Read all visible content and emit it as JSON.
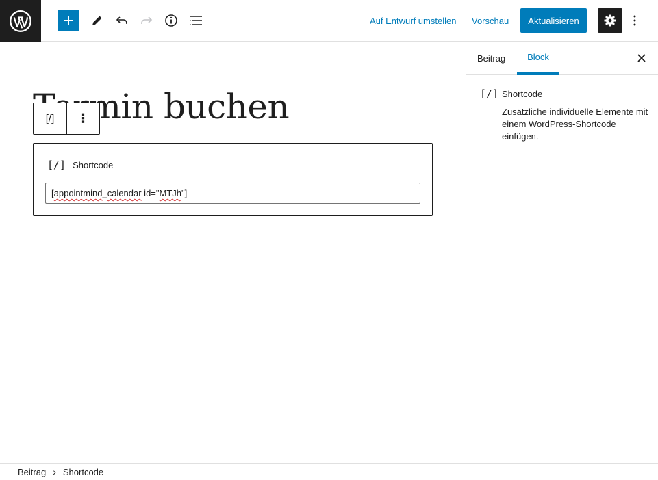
{
  "toolbar": {
    "switch_to_draft": "Auf Entwurf umstellen",
    "preview": "Vorschau",
    "update": "Aktualisieren"
  },
  "icons": {
    "logo": "wordpress-icon",
    "inserter": "plus-icon",
    "tools": "pencil-icon",
    "undo": "undo-icon",
    "redo": "redo-icon",
    "details": "info-icon",
    "list_view": "list-view-icon",
    "settings": "gear-icon",
    "options": "vertical-dots-icon"
  },
  "editor": {
    "title": "Termin buchen",
    "block_toolbar": {
      "block_icon": "[/]",
      "options_icon": "⋮"
    },
    "shortcode_block": {
      "icon": "[/]",
      "label": "Shortcode",
      "input_value_parts": [
        "[",
        "appointmind",
        "_",
        "calendar",
        " id=\"",
        "MTJh",
        "\"]"
      ]
    }
  },
  "sidebar": {
    "tabs": [
      "Beitrag",
      "Block"
    ],
    "active_tab": "Block",
    "block_card": {
      "icon": "[/]",
      "title": "Shortcode",
      "description": "Zusätzliche individuelle Elemente mit einem WordPress-Shortcode einfügen."
    }
  },
  "breadcrumb": {
    "items": [
      "Beitrag",
      "Shortcode"
    ],
    "separator": "›"
  },
  "colors": {
    "accent": "#007cba",
    "dark": "#1e1e1e",
    "border": "#e0e0e0",
    "spellcheck": "#d63638"
  }
}
